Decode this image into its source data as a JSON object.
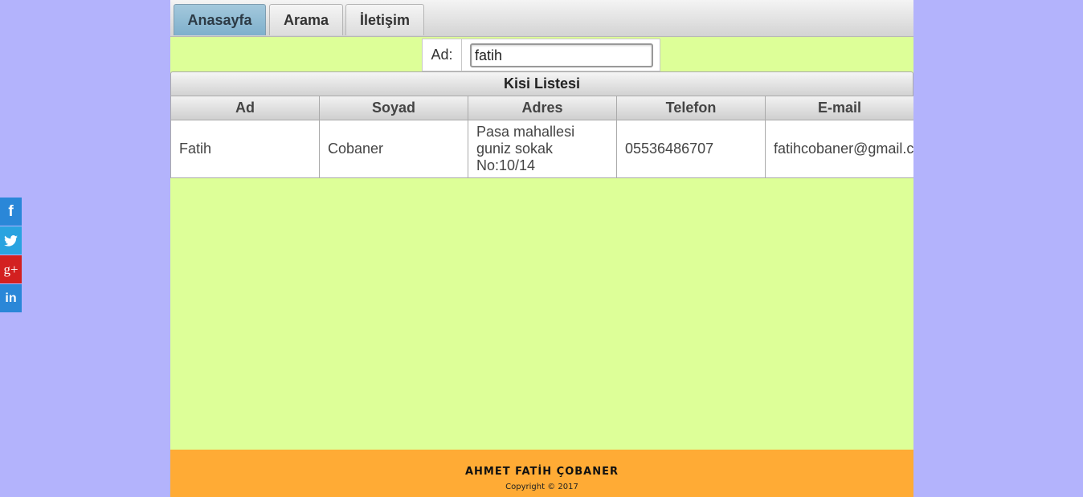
{
  "social": [
    {
      "icon": "facebook-icon",
      "glyph": "f",
      "color": "#2a87d8"
    },
    {
      "icon": "twitter-icon",
      "glyph": "",
      "color": "#2aa3e0"
    },
    {
      "icon": "google-plus-icon",
      "glyph": "g+",
      "color": "#d32020"
    },
    {
      "icon": "linkedin-icon",
      "glyph": "in",
      "color": "#2a87d8"
    }
  ],
  "tabs": [
    {
      "label": "Anasayfa",
      "active": true
    },
    {
      "label": "Arama",
      "active": false
    },
    {
      "label": "İletişim",
      "active": false
    }
  ],
  "search": {
    "label": "Ad:",
    "value": "fatih"
  },
  "table": {
    "caption": "Kisi Listesi",
    "columns": [
      "Ad",
      "Soyad",
      "Adres",
      "Telefon",
      "E-mail"
    ],
    "rows": [
      {
        "ad": "Fatih",
        "soyad": "Cobaner",
        "adres": "Pasa mahallesi guniz sokak No:10/14",
        "telefon": "05536486707",
        "email": "fatihcobaner@gmail.com"
      }
    ]
  },
  "footer": {
    "name": "AHMET FATİH ÇOBANER",
    "copyright": "Copyright © 2017"
  },
  "colors": {
    "page_bg": "#b3b3fc",
    "content_bg": "#ddff98",
    "footer_bg": "#ffab35",
    "active_tab": "#8fbbd3"
  }
}
